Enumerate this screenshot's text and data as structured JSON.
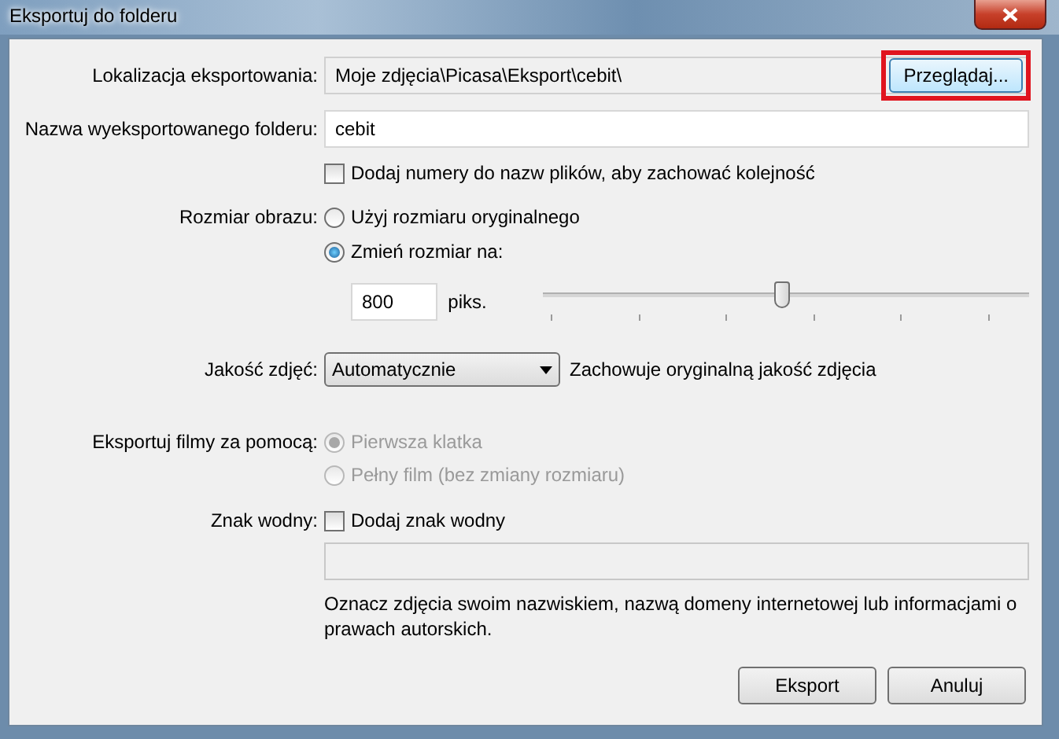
{
  "window": {
    "title": "Eksportuj do folderu"
  },
  "location": {
    "label": "Lokalizacja eksportowania:",
    "value": "Moje zdjęcia\\Picasa\\Eksport\\cebit\\",
    "browse_button": {
      "label": "Przeglądaj...",
      "highlighted": true
    }
  },
  "folder_name": {
    "label": "Nazwa wyeksportowanego folderu:",
    "value": "cebit"
  },
  "numbering": {
    "label": "Dodaj numery do nazw plików, aby zachować kolejność",
    "checked": false
  },
  "image_size": {
    "label": "Rozmiar obrazu:",
    "options": [
      {
        "label": "Użyj rozmiaru oryginalnego",
        "selected": false
      },
      {
        "label": "Zmień rozmiar na:",
        "selected": true
      }
    ],
    "size_value": "800",
    "unit": "piks.",
    "slider": {
      "level": 0.49
    }
  },
  "quality": {
    "label": "Jakość zdjęć:",
    "value": "Automatycznie",
    "description": "Zachowuje oryginalną jakość zdjęcia"
  },
  "movies": {
    "label": "Eksportuj filmy za pomocą:",
    "disabled": true,
    "options": [
      {
        "label": "Pierwsza klatka",
        "selected": true
      },
      {
        "label": "Pełny film (bez zmiany rozmiaru)",
        "selected": false
      }
    ]
  },
  "watermark": {
    "label": "Znak wodny:",
    "checkbox": {
      "label": "Dodaj znak wodny",
      "checked": false
    },
    "field_disabled": true,
    "description": "Oznacz zdjęcia swoim nazwiskiem, nazwą domeny internetowej lub informacjami o prawach autorskich."
  },
  "buttons": [
    {
      "label": "Eksport"
    },
    {
      "label": "Anuluj"
    }
  ]
}
